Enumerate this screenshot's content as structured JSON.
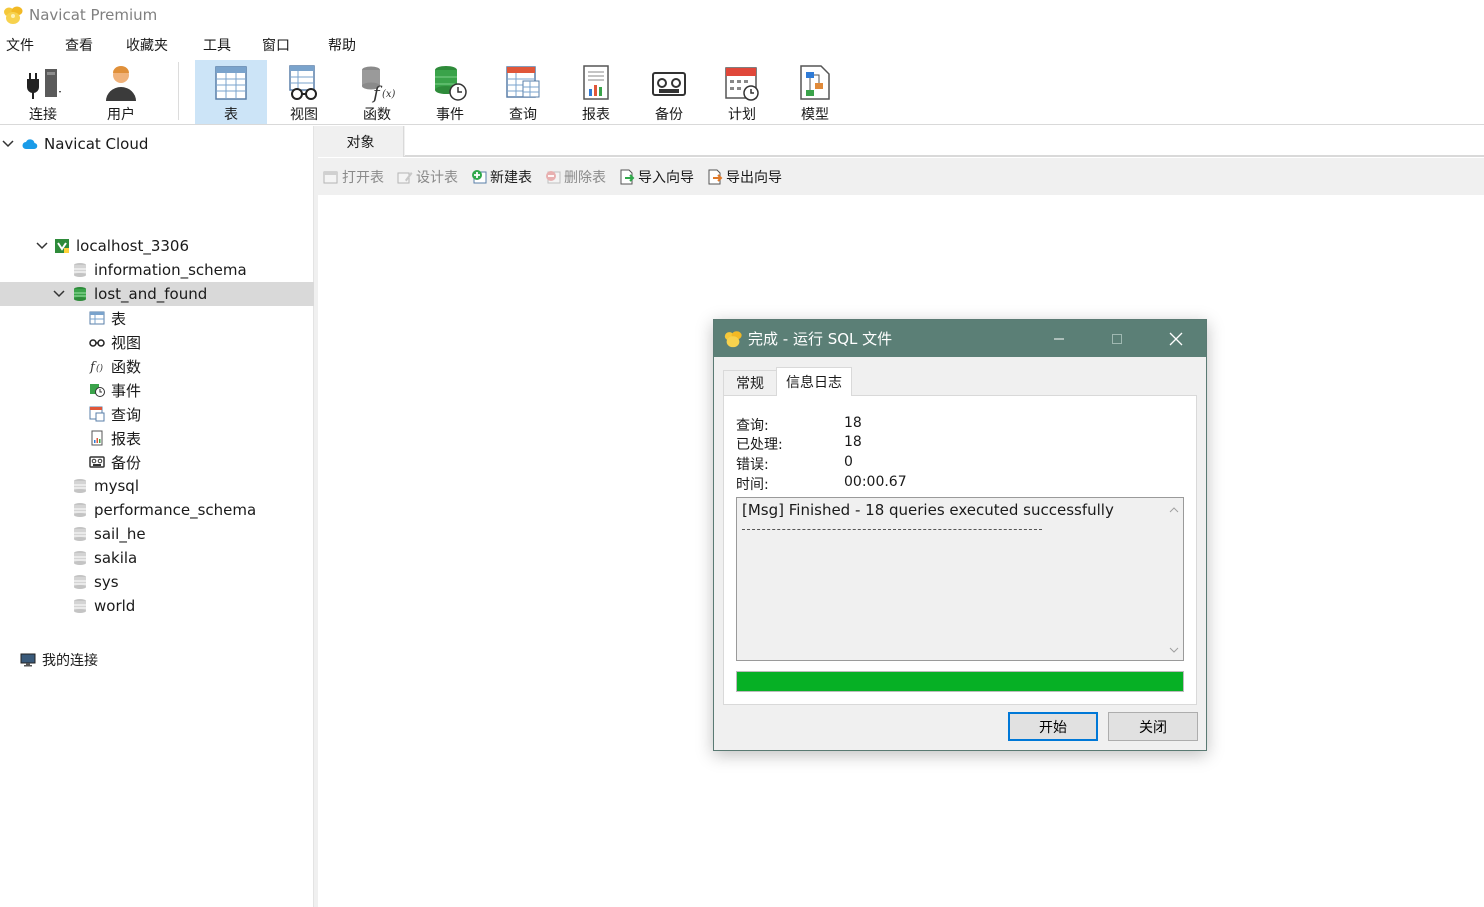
{
  "window": {
    "title": "Navicat Premium"
  },
  "menu": [
    "文件",
    "查看",
    "收藏夹",
    "工具",
    "窗口",
    "帮助"
  ],
  "toolbar": {
    "connect": "连接",
    "user": "用户",
    "table": "表",
    "view": "视图",
    "function": "函数",
    "event": "事件",
    "query": "查询",
    "report": "报表",
    "backup": "备份",
    "schedule": "计划",
    "model": "模型"
  },
  "sidebar": {
    "cloud": "Navicat Cloud",
    "connection": "localhost_3306",
    "databases": [
      "information_schema",
      "lost_and_found",
      "mysql",
      "performance_schema",
      "sail_he",
      "sakila",
      "sys",
      "world"
    ],
    "selected_db": "lost_and_found",
    "children": [
      "表",
      "视图",
      "函数",
      "事件",
      "查询",
      "报表",
      "备份"
    ],
    "my_connections": "我的连接"
  },
  "main": {
    "tab": "对象",
    "actions": {
      "open_table": "打开表",
      "design_table": "设计表",
      "new_table": "新建表",
      "delete_table": "删除表",
      "import_wizard": "导入向导",
      "export_wizard": "导出向导"
    }
  },
  "dialog": {
    "title": "完成 - 运行 SQL 文件",
    "tabs": [
      "常规",
      "信息日志"
    ],
    "active_tab": "信息日志",
    "stats": {
      "queries_label": "查询:",
      "queries_value": "18",
      "processed_label": "已处理:",
      "processed_value": "18",
      "errors_label": "错误:",
      "errors_value": "0",
      "time_label": "时间:",
      "time_value": "00:00.67"
    },
    "log": "[Msg] Finished - 18 queries executed successfully",
    "progress": 1.0,
    "start_button": "开始",
    "close_button": "关闭"
  },
  "colors": {
    "dialog_title_bg": "#5b7f76",
    "progress_fill": "#06b025",
    "selected_toolbar": "#cce4f7",
    "db_active": "#3aa33a"
  }
}
